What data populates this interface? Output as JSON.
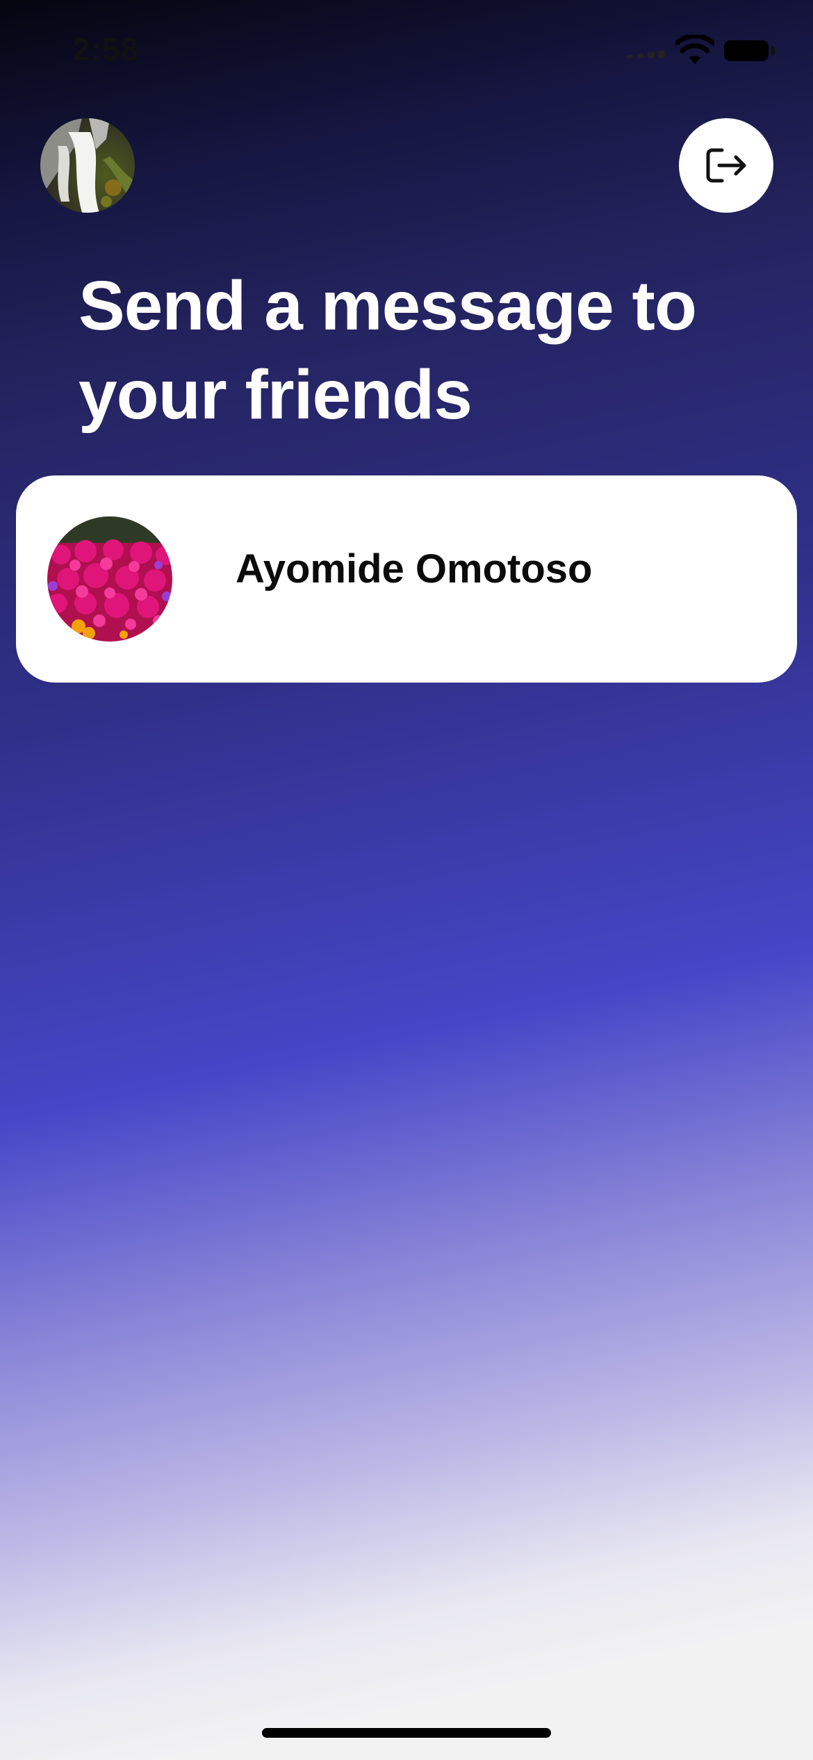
{
  "status_bar": {
    "time": "2:58"
  },
  "header": {
    "profile_avatar": "profile-avatar-waterfall-photo",
    "logout_icon": "logout-icon"
  },
  "main": {
    "title": "Send a message to your friends",
    "friends": [
      {
        "name": "Ayomide Omotoso",
        "avatar": "avatar-flowers-photo"
      }
    ]
  },
  "colors": {
    "gradient_top": "#05050f",
    "gradient_mid": "#4646c7",
    "gradient_bottom": "#f2f2f3",
    "card_background": "#ffffff",
    "title_text": "#ffffff"
  }
}
